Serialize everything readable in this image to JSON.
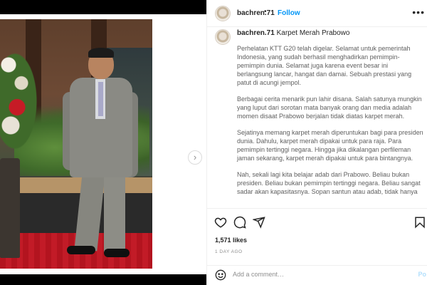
{
  "post": {
    "author": {
      "username": "bachren.71",
      "separator": "•",
      "follow_label": "Follow"
    },
    "more_label": "•••",
    "media": {
      "description_icon": "photo",
      "next_arrow": "›"
    },
    "caption": {
      "username": "bachren.71",
      "title": "Karpet Merah Prabowo",
      "paragraphs": [
        "Perhelatan KTT G20 telah digelar. Selamat untuk pemerintah Indonesia, yang sudah berhasil menghadirkan pemimpin-pemimpin dunia. Selamat juga karena event besar ini berlangsung lancar, hangat dan damai. Sebuah prestasi yang patut di acungi jempol.",
        "Berbagai cerita menarik pun lahir disana. Salah satunya mungkin yang luput dari sorotan mata banyak orang dan media adalah momen disaat Prabowo berjalan tidak diatas karpet merah.",
        "Sejatinya memang karpet merah diperuntukan bagi para presiden dunia. Dahulu, karpet merah dipakai untuk para raja. Para pemimpin tertinggi negara. Hingga jika dikalangan perfileman jaman sekarang, karpet merah dipakai untuk para bintangnya.",
        "Nah, sekali lagi kita belajar adab dari Prabowo. Beliau bukan presiden. Beliau bukan pemimpin tertinggi negara. Beliau sangat sadar akan kapasitasnya. Sopan santun atau adab, tidak hanya"
      ]
    },
    "actions": {
      "icons": [
        "heart-icon",
        "comment-icon",
        "share-icon",
        "bookmark-icon"
      ]
    },
    "likes": "1,571 likes",
    "date": "1 DAY AGO",
    "comment_box": {
      "placeholder": "Add a comment…",
      "post_label": "Po"
    }
  },
  "colors": {
    "link_blue": "#0095f6",
    "carpet_red": "#c21b27",
    "text_secondary": "#8e8e8e"
  }
}
